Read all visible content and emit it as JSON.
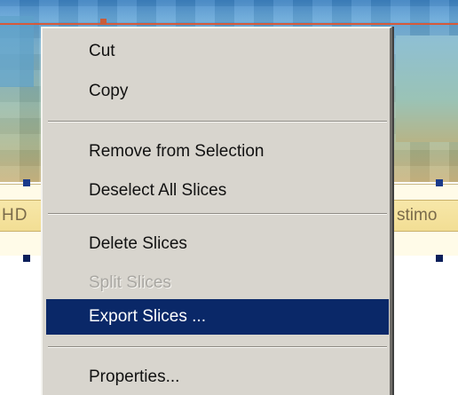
{
  "context_menu": {
    "items": [
      {
        "label": "Cut",
        "enabled": true,
        "selected": false
      },
      {
        "label": "Copy",
        "enabled": true,
        "selected": false
      },
      {
        "label": "Remove from Selection",
        "enabled": true,
        "selected": false
      },
      {
        "label": "Deselect All Slices",
        "enabled": true,
        "selected": false
      },
      {
        "label": "Delete Slices",
        "enabled": true,
        "selected": false
      },
      {
        "label": "Split Slices",
        "enabled": false,
        "selected": false
      },
      {
        "label": "Export Slices ...",
        "enabled": true,
        "selected": true
      },
      {
        "label": "Properties...",
        "enabled": true,
        "selected": false
      }
    ],
    "colors": {
      "menu_background": "#d8d5ce",
      "selection_background": "#0a2868",
      "selection_text": "#ffffff",
      "disabled_text": "#a9a7a2"
    }
  },
  "canvas": {
    "band_text_left": "HD",
    "band_text_right": "stimo"
  }
}
